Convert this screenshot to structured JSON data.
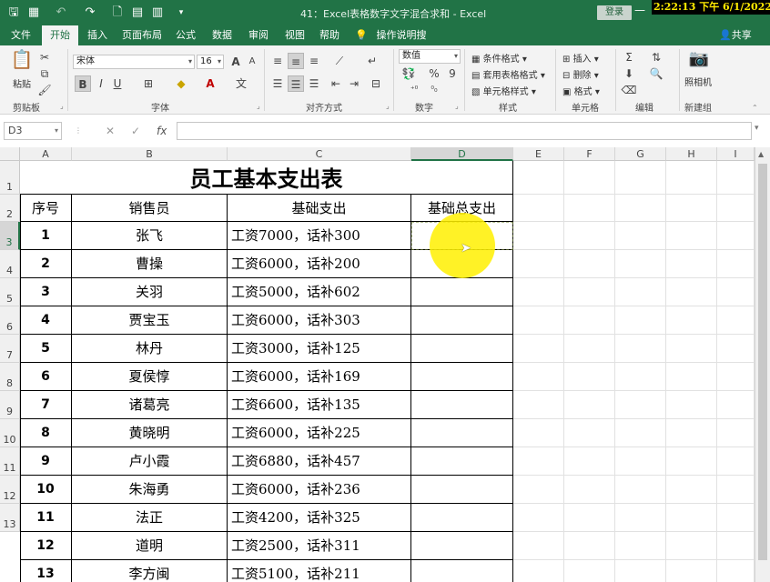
{
  "titlebar": {
    "title": "41：Excel表格数字文字混合求和  -  Excel",
    "login_label": "登录",
    "dash": "—",
    "clock": "2:22:13 下午 6/1/2022 🗆",
    "qa_icons": [
      "save-icon",
      "grid-icon",
      "undo-icon",
      "redo-icon",
      "preview-icon",
      "table-icon",
      "chart-icon",
      "more-icon"
    ]
  },
  "tabs": [
    {
      "label": "文件"
    },
    {
      "label": "开始",
      "active": true
    },
    {
      "label": "插入"
    },
    {
      "label": "页面布局"
    },
    {
      "label": "公式"
    },
    {
      "label": "数据"
    },
    {
      "label": "审阅"
    },
    {
      "label": "视图"
    },
    {
      "label": "帮助"
    },
    {
      "label": "操作说明搜索"
    }
  ],
  "share_label": "共享",
  "ribbon": {
    "clipboard": {
      "paste": "粘贴",
      "label": "剪贴板"
    },
    "font": {
      "name": "宋体",
      "size": "16",
      "bold": "B",
      "italic": "I",
      "underline": "U",
      "grow": "A",
      "shrink": "A",
      "label": "字体"
    },
    "alignment": {
      "label": "对齐方式"
    },
    "number": {
      "format": "数值",
      "percent": "%",
      "comma": "9",
      "label": "数字"
    },
    "styles": {
      "conditional": "条件格式",
      "table": "套用表格格式",
      "cell": "单元格样式",
      "label": "样式"
    },
    "cells": {
      "insert": "插入",
      "delete": "删除",
      "format": "格式",
      "label": "单元格"
    },
    "editing": {
      "label": "编辑"
    },
    "camera": {
      "button": "照相机",
      "label": "新建组"
    }
  },
  "formula_bar": {
    "name_box": "D3",
    "cancel": "✕",
    "confirm": "✓",
    "fx": "fx",
    "value": ""
  },
  "columns": [
    "A",
    "B",
    "C",
    "D",
    "E",
    "F",
    "G",
    "H",
    "I"
  ],
  "rows": [
    "1",
    "2",
    "3",
    "4",
    "5",
    "6",
    "7",
    "8",
    "9",
    "10",
    "11",
    "12",
    "13"
  ],
  "sheet": {
    "title": "员工基本支出表",
    "headers": [
      "序号",
      "销售员",
      "基础支出",
      "基础总支出"
    ],
    "data": [
      [
        "1",
        "张飞",
        "工资7000，话补300"
      ],
      [
        "2",
        "曹操",
        "工资6000，话补200"
      ],
      [
        "3",
        "关羽",
        "工资5000，话补602"
      ],
      [
        "4",
        "贾宝玉",
        "工资6000，话补303"
      ],
      [
        "5",
        "林丹",
        "工资3000，话补125"
      ],
      [
        "6",
        "夏侯惇",
        "工资6000，话补169"
      ],
      [
        "7",
        "诸葛亮",
        "工资6600，话补135"
      ],
      [
        "8",
        "黄晓明",
        "工资6000，话补225"
      ],
      [
        "9",
        "卢小霞",
        "工资6880，话补457"
      ],
      [
        "10",
        "朱海勇",
        "工资6000，话补236"
      ],
      [
        "11",
        "法正",
        "工资4200，话补325"
      ],
      [
        "12",
        "道明",
        "工资2500，话补311"
      ],
      [
        "13",
        "李方闽",
        "工资5100，话补211"
      ]
    ]
  },
  "colors": {
    "accent": "#217346",
    "highlight": "#fff000"
  }
}
